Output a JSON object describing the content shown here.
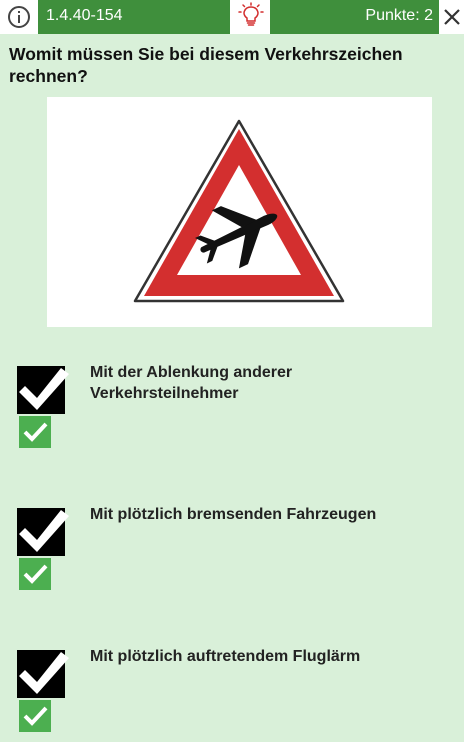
{
  "header": {
    "question_id": "1.4.40-154",
    "points_label": "Punkte: 2",
    "info_icon": "info-icon",
    "hint_icon": "lightbulb-icon",
    "close_icon": "close-icon"
  },
  "question": {
    "text": "Womit müssen Sie bei diesem Verkehrszeichen rechnen?"
  },
  "sign": {
    "icon": "airplane-warning-sign",
    "border_color": "#d32f2f"
  },
  "answers": [
    {
      "text": "Mit der Ablenkung anderer Verkehrsteilnehmer",
      "checked": true,
      "correct": true
    },
    {
      "text": "Mit plötzlich bremsenden Fahrzeugen",
      "checked": true,
      "correct": true
    },
    {
      "text": "Mit plötzlich auftretendem Fluglärm",
      "checked": true,
      "correct": true
    }
  ],
  "colors": {
    "accent_green": "#3f8f3c",
    "background": "#d9f0d9",
    "check_green": "#4caf50"
  }
}
